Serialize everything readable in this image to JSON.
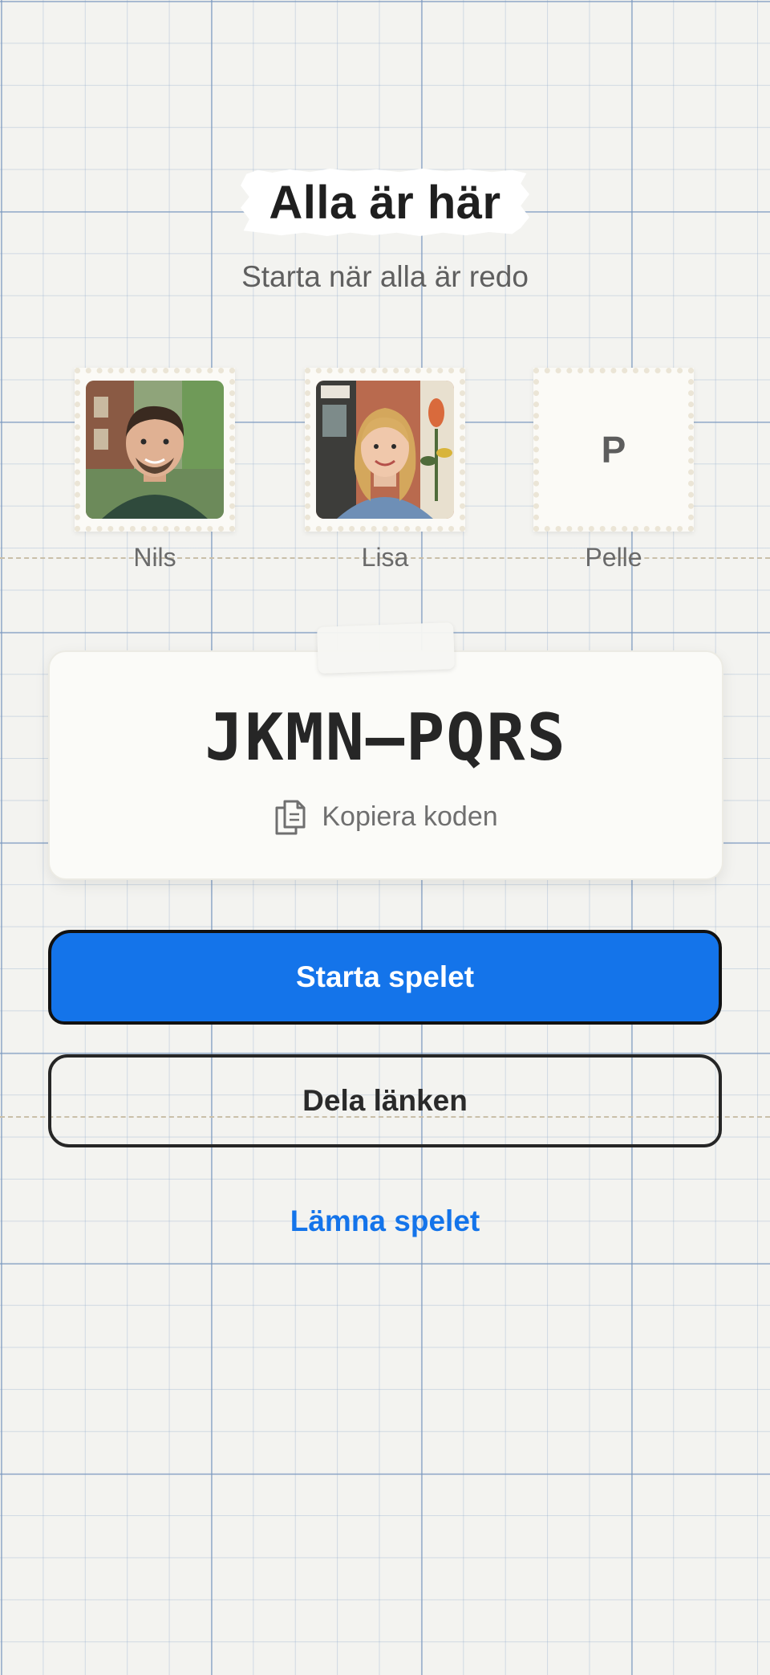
{
  "header": {
    "title": "Alla är här",
    "subtitle": "Starta när alla är redo"
  },
  "players": [
    {
      "name": "Nils",
      "avatar": "photo",
      "initial": ""
    },
    {
      "name": "Lisa",
      "avatar": "photo",
      "initial": ""
    },
    {
      "name": "Pelle",
      "avatar": "initial",
      "initial": "P"
    }
  ],
  "code_card": {
    "code": "JKMN–PQRS",
    "copy_label": "Kopiera koden",
    "copy_icon": "copy-icon"
  },
  "actions": {
    "start_label": "Starta spelet",
    "share_label": "Dela länken",
    "leave_label": "Lämna spelet"
  },
  "colors": {
    "accent": "#1474ea",
    "background": "#f3f3f0",
    "text": "#1f1f1f"
  }
}
